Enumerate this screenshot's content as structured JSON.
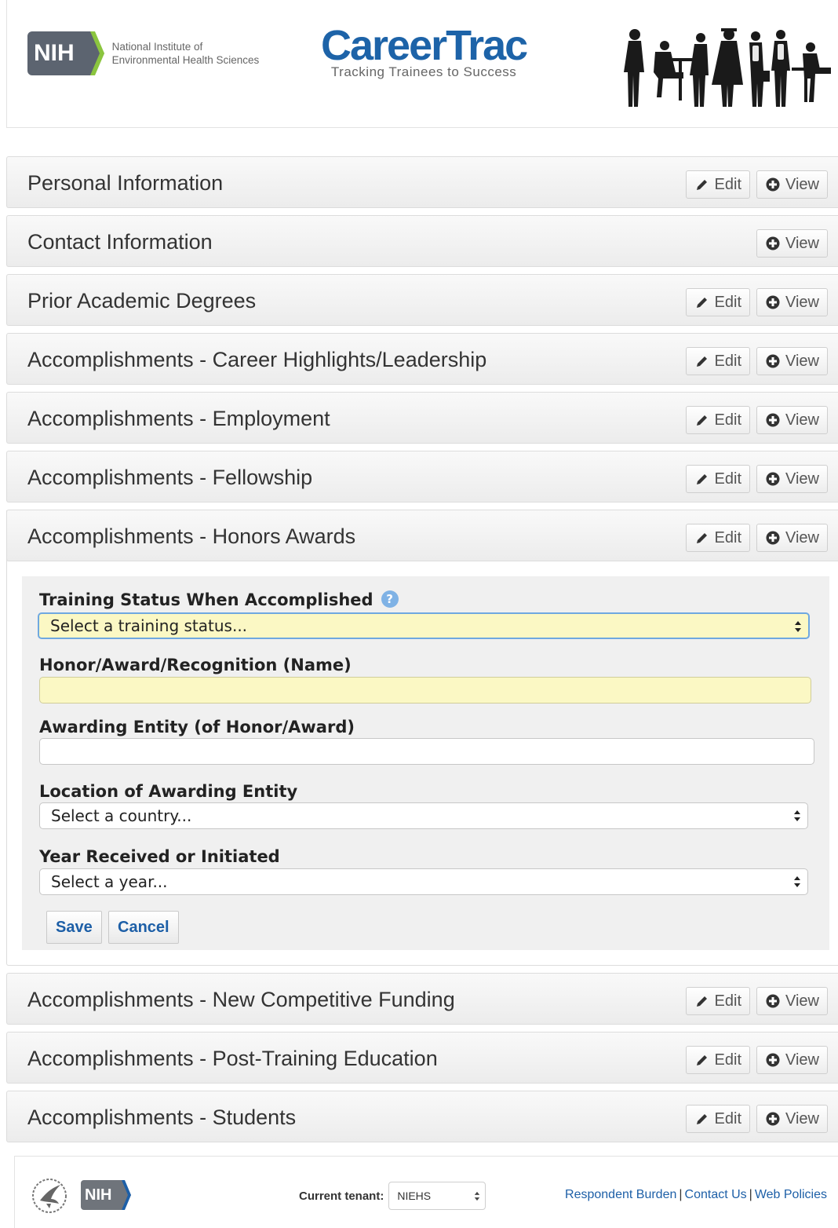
{
  "header": {
    "nih_abbrev": "NIH",
    "nih_line1": "National Institute of",
    "nih_line2": "Environmental Health Sciences",
    "app_title": "CareerTrac",
    "app_tagline": "Tracking Trainees to Success"
  },
  "sections": [
    {
      "title": "Personal Information",
      "edit": "Edit",
      "view": "View"
    },
    {
      "title": "Contact Information",
      "view": "View"
    },
    {
      "title": "Prior Academic Degrees",
      "edit": "Edit",
      "view": "View"
    },
    {
      "title": "Accomplishments - Career Highlights/Leadership",
      "edit": "Edit",
      "view": "View"
    },
    {
      "title": "Accomplishments - Employment",
      "edit": "Edit",
      "view": "View"
    },
    {
      "title": "Accomplishments - Fellowship",
      "edit": "Edit",
      "view": "View"
    },
    {
      "title": "Accomplishments - Honors Awards",
      "edit": "Edit",
      "view": "View"
    },
    {
      "title": "Accomplishments - New Competitive Funding",
      "edit": "Edit",
      "view": "View"
    },
    {
      "title": "Accomplishments - Post-Training Education",
      "edit": "Edit",
      "view": "View"
    },
    {
      "title": "Accomplishments - Students",
      "edit": "Edit",
      "view": "View"
    }
  ],
  "form": {
    "training_status_label": "Training Status When Accomplished",
    "help_glyph": "?",
    "training_status_value": "Select a training status...",
    "honor_name_label": "Honor/Award/Recognition (Name)",
    "honor_name_value": "",
    "awarding_entity_label": "Awarding Entity (of Honor/Award)",
    "awarding_entity_value": "",
    "location_label": "Location of Awarding Entity",
    "location_value": "Select a country...",
    "year_label": "Year Received or Initiated",
    "year_value": "Select a year...",
    "save_label": "Save",
    "cancel_label": "Cancel"
  },
  "footer": {
    "nih_abbrev": "NIH",
    "tenant_label": "Current tenant:",
    "tenant_value": "NIEHS",
    "links": [
      "Respondent Burden",
      "Contact Us",
      "Web Policies"
    ],
    "separator": "|"
  },
  "colors": {
    "brand_blue": "#1d63a8",
    "link_blue": "#1d5fa7",
    "highlight_yellow": "#fbf8c4",
    "focus_border": "#6fa8e0"
  }
}
